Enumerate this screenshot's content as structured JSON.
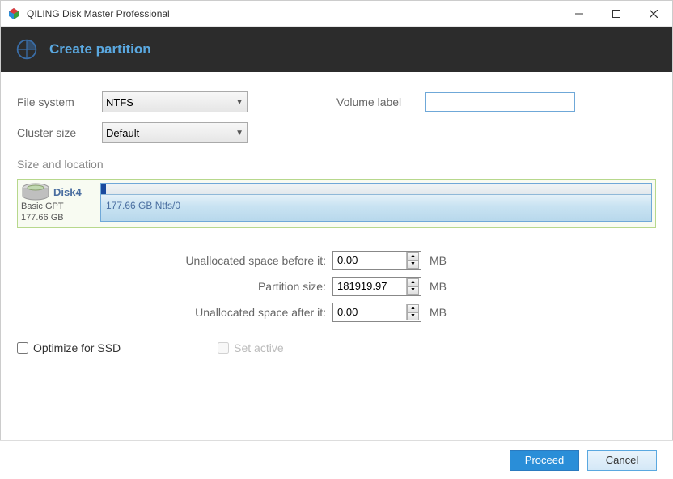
{
  "window": {
    "title": "QILING Disk Master Professional"
  },
  "header": {
    "title": "Create partition"
  },
  "form": {
    "file_system_label": "File system",
    "file_system_value": "NTFS",
    "cluster_size_label": "Cluster size",
    "cluster_size_value": "Default",
    "volume_label_label": "Volume label",
    "volume_label_value": ""
  },
  "size_location_label": "Size and location",
  "disk": {
    "name": "Disk4",
    "type_line": "Basic GPT",
    "size_line": "177.66 GB",
    "partition_text": "177.66 GB Ntfs/0"
  },
  "spin": {
    "before_label": "Unallocated space before it:",
    "before_value": "0.00",
    "size_label": "Partition size:",
    "size_value": "181919.97",
    "after_label": "Unallocated space after it:",
    "after_value": "0.00",
    "unit": "MB"
  },
  "checks": {
    "optimize_ssd": "Optimize for SSD",
    "set_active": "Set active"
  },
  "buttons": {
    "proceed": "Proceed",
    "cancel": "Cancel"
  }
}
